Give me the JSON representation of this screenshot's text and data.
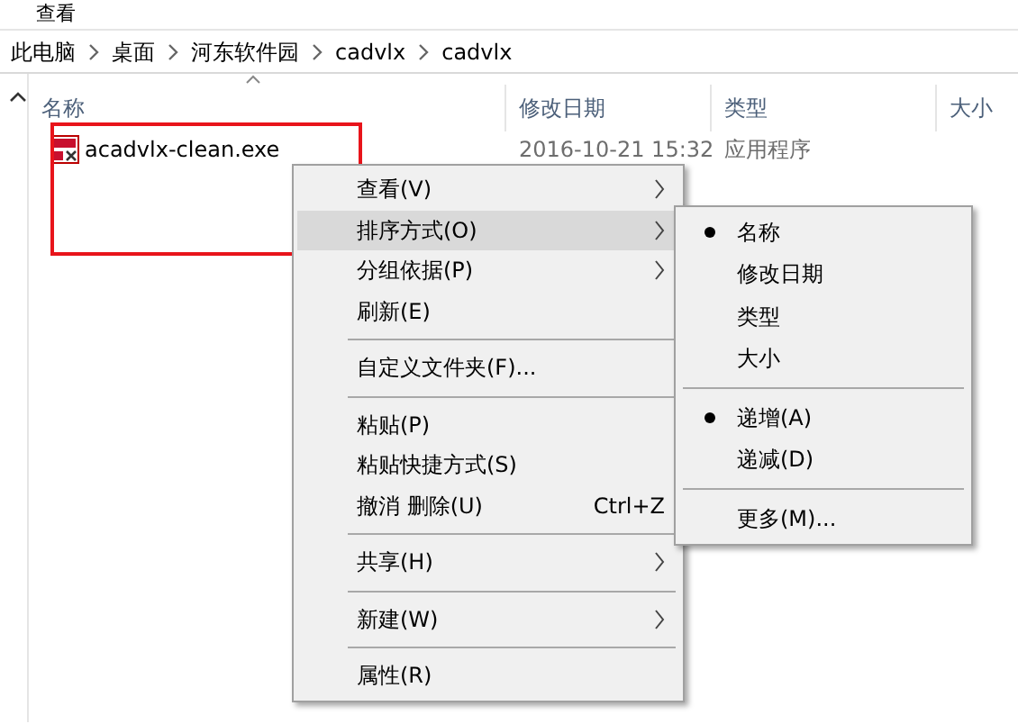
{
  "ribbon_tab": "查看",
  "breadcrumb": [
    "此电脑",
    "桌面",
    "河东软件园",
    "cadvlx",
    "cadvlx"
  ],
  "columns": [
    {
      "label": "名称",
      "sorted": true
    },
    {
      "label": "修改日期",
      "sorted": false
    },
    {
      "label": "类型",
      "sorted": false
    },
    {
      "label": "大小",
      "sorted": false
    }
  ],
  "files": [
    {
      "name": "acadvlx-clean.exe",
      "modified": "2016-10-21 15:32",
      "type": "应用程序"
    }
  ],
  "context_menu": [
    {
      "kind": "item",
      "label": "查看(V)",
      "submenu": true,
      "selected": false
    },
    {
      "kind": "item",
      "label": "排序方式(O)",
      "submenu": true,
      "selected": true
    },
    {
      "kind": "item",
      "label": "分组依据(P)",
      "submenu": true,
      "selected": false
    },
    {
      "kind": "item",
      "label": "刷新(E)",
      "submenu": false,
      "selected": false
    },
    {
      "kind": "separator"
    },
    {
      "kind": "item",
      "label": "自定义文件夹(F)...",
      "submenu": false,
      "selected": false
    },
    {
      "kind": "separator"
    },
    {
      "kind": "item",
      "label": "粘贴(P)",
      "submenu": false,
      "selected": false
    },
    {
      "kind": "item",
      "label": "粘贴快捷方式(S)",
      "submenu": false,
      "selected": false
    },
    {
      "kind": "item",
      "label": "撤消 删除(U)",
      "shortcut": "Ctrl+Z",
      "submenu": false,
      "selected": false
    },
    {
      "kind": "separator"
    },
    {
      "kind": "item",
      "label": "共享(H)",
      "submenu": true,
      "selected": false
    },
    {
      "kind": "separator"
    },
    {
      "kind": "item",
      "label": "新建(W)",
      "submenu": true,
      "selected": false
    },
    {
      "kind": "separator"
    },
    {
      "kind": "item",
      "label": "属性(R)",
      "submenu": false,
      "selected": false
    }
  ],
  "sort_submenu": [
    {
      "kind": "item",
      "label": "名称",
      "checked": true
    },
    {
      "kind": "item",
      "label": "修改日期",
      "checked": false
    },
    {
      "kind": "item",
      "label": "类型",
      "checked": false
    },
    {
      "kind": "item",
      "label": "大小",
      "checked": false
    },
    {
      "kind": "separator"
    },
    {
      "kind": "item",
      "label": "递增(A)",
      "checked": true
    },
    {
      "kind": "item",
      "label": "递减(D)",
      "checked": false
    },
    {
      "kind": "separator"
    },
    {
      "kind": "item",
      "label": "更多(M)...",
      "checked": false
    }
  ]
}
